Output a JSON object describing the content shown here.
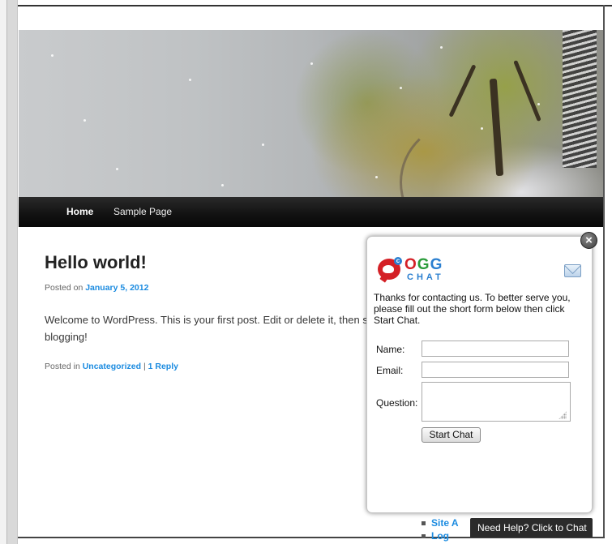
{
  "nav": {
    "home_label": "Home",
    "sample_label": "Sample Page"
  },
  "post": {
    "title": "Hello world!",
    "posted_on_prefix": "Posted on ",
    "date": "January 5, 2012",
    "body": "Welcome to WordPress. This is your first post. Edit or delete it, then s",
    "body_line2": "blogging!",
    "posted_in_prefix": "Posted in ",
    "category": "Uncategorized",
    "separator": " | ",
    "reply_link": "1 Reply"
  },
  "sidebar": {
    "items": [
      {
        "label": "Site A"
      },
      {
        "label": "Log"
      }
    ]
  },
  "chat": {
    "logo_main": "OGG",
    "logo_sub": "CHAT",
    "intro": "Thanks for contacting us. To better serve you, please fill out the short form below then click Start Chat.",
    "name_label": "Name:",
    "email_label": "Email:",
    "question_label": "Question:",
    "name_value": "",
    "email_value": "",
    "start_label": "Start Chat",
    "close_glyph": "×",
    "help_label": "Need Help? Click to Chat"
  },
  "icons": {
    "close": "close-icon",
    "mail": "mail-icon",
    "logo": "ogg-chat-logo"
  }
}
